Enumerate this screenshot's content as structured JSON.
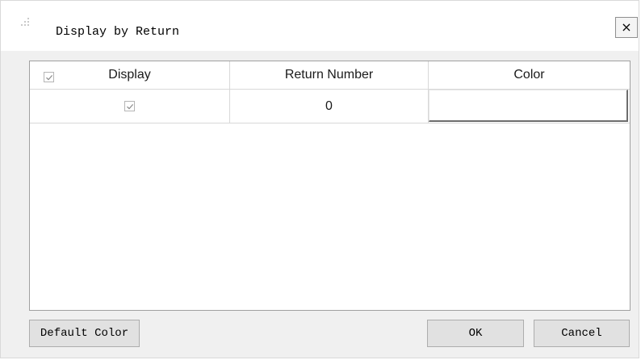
{
  "dialog": {
    "title": "Display by Return",
    "icons": {
      "grip": "drag-grip-icon",
      "close": "close-icon"
    },
    "close_label": "×"
  },
  "table": {
    "header_checkbox_checked": true,
    "columns": [
      "Display",
      "Return Number",
      "Color"
    ],
    "rows": [
      {
        "display_checked": true,
        "return_number": "0",
        "color": "#ffffff"
      }
    ]
  },
  "buttons": {
    "default_color": "Default Color",
    "ok": "OK",
    "cancel": "Cancel"
  }
}
